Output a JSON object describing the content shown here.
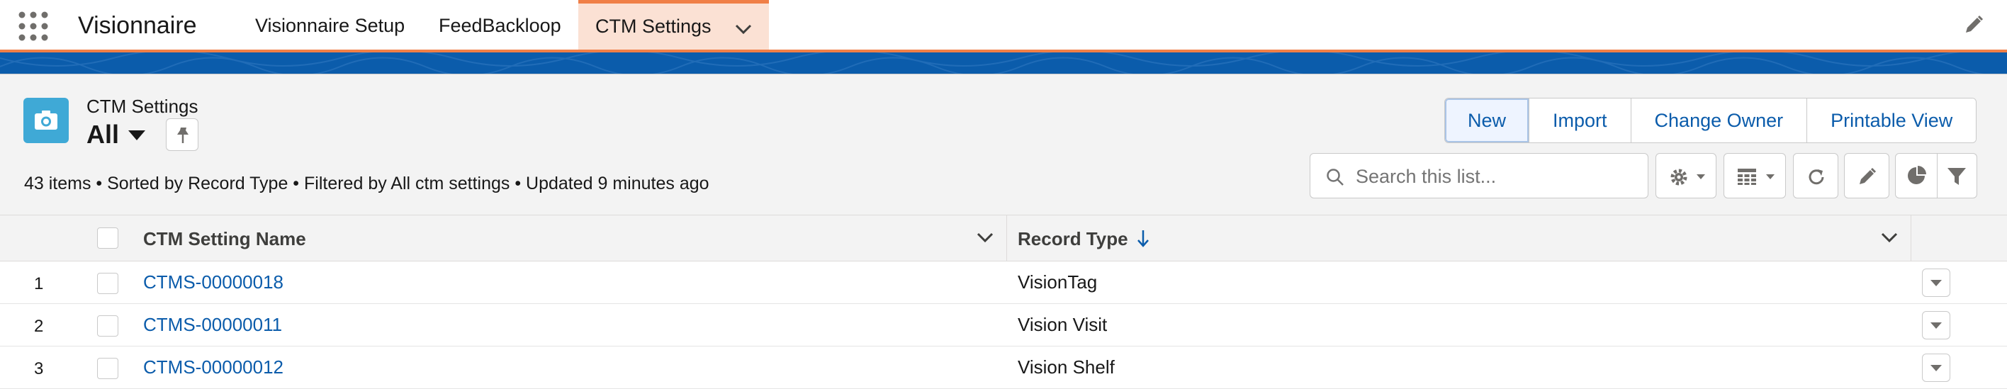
{
  "nav": {
    "app_name": "Visionnaire",
    "items": [
      {
        "label": "Visionnaire Setup"
      },
      {
        "label": "FeedBackloop"
      },
      {
        "label": "CTM Settings"
      }
    ]
  },
  "header": {
    "object_type": "CTM Settings",
    "list_view": "All",
    "summary": "43 items • Sorted by Record Type • Filtered by All ctm settings • Updated 9 minutes ago"
  },
  "actions": {
    "buttons": [
      "New",
      "Import",
      "Change Owner",
      "Printable View"
    ]
  },
  "search": {
    "placeholder": "Search this list..."
  },
  "table": {
    "columns": [
      {
        "label": "CTM Setting Name"
      },
      {
        "label": "Record Type"
      }
    ],
    "rows": [
      {
        "num": "1",
        "name": "CTMS-00000018",
        "record_type": "VisionTag"
      },
      {
        "num": "2",
        "name": "CTMS-00000011",
        "record_type": "Vision Visit"
      },
      {
        "num": "3",
        "name": "CTMS-00000012",
        "record_type": "Vision Shelf"
      }
    ]
  },
  "colors": {
    "accent": "#f07f47",
    "brand_blue": "#0b5cab",
    "object_icon": "#3fa9d6",
    "link": "#0b5cab"
  },
  "icons": [
    "app-launcher-icon",
    "chevron-down-icon",
    "edit-icon",
    "camera-icon",
    "pin-icon",
    "search-icon",
    "settings-icon",
    "table-view-icon",
    "refresh-icon",
    "chart-icon",
    "filter-icon"
  ]
}
